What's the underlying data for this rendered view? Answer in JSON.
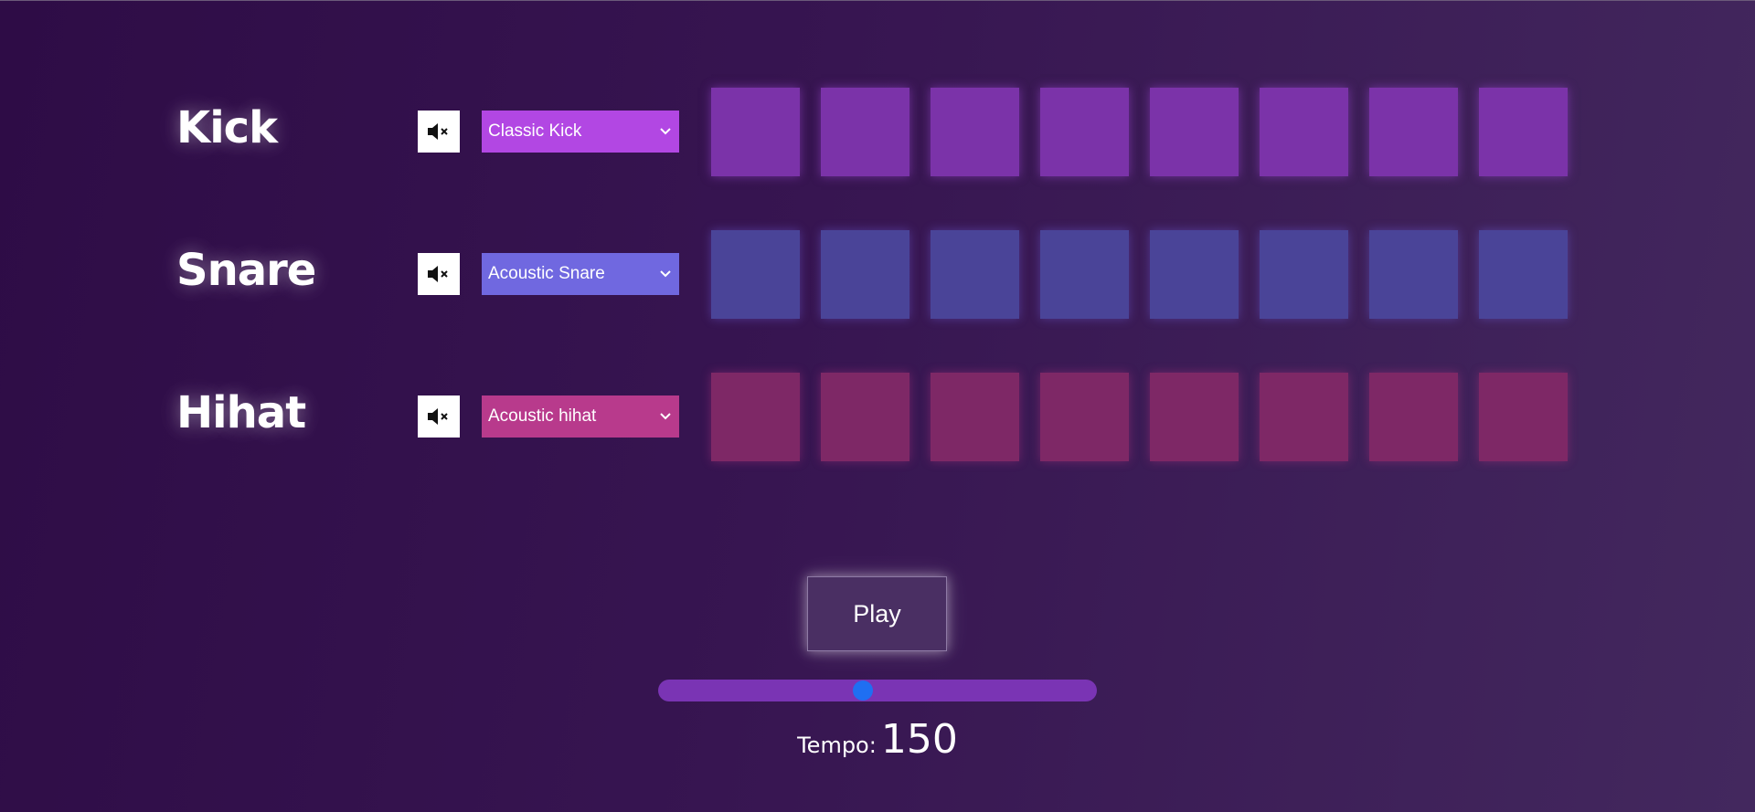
{
  "colors": {
    "kick_accent": "#b247e3",
    "snare_accent": "#7068e0",
    "hihat_accent": "#b83a8c",
    "slider_track": "#7a34b4",
    "slider_thumb": "#1f6ff2"
  },
  "tracks": [
    {
      "name": "Kick",
      "mute_icon": "speaker-muted-icon",
      "sound": "Classic Kick",
      "pads": 8
    },
    {
      "name": "Snare",
      "mute_icon": "speaker-muted-icon",
      "sound": "Acoustic Snare",
      "pads": 8
    },
    {
      "name": "Hihat",
      "mute_icon": "speaker-muted-icon",
      "sound": "Acoustic hihat",
      "pads": 8
    }
  ],
  "controls": {
    "play_label": "Play",
    "tempo_label": "Tempo:",
    "tempo_value": "150",
    "tempo_slider_fraction": 0.467
  }
}
